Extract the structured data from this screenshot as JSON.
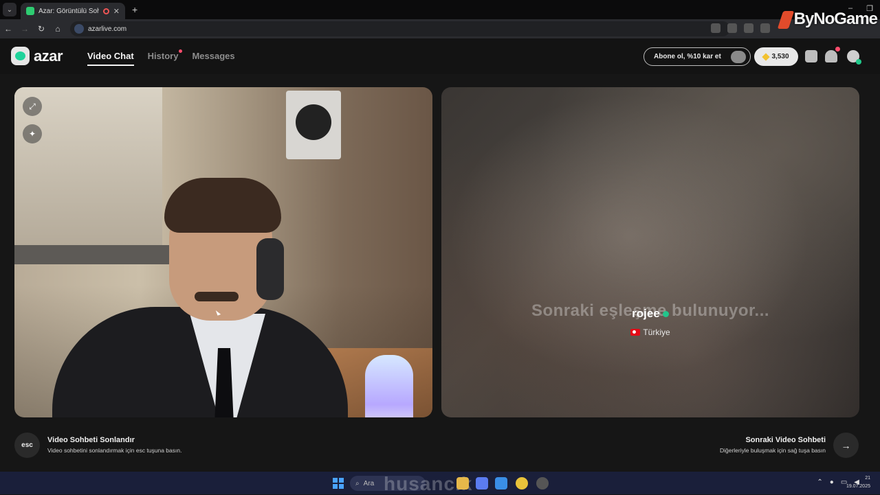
{
  "browser": {
    "tab_title": "Azar: Görüntülü Sohbet & V",
    "url": "azarlive.com"
  },
  "watermark": {
    "text": "ByNoGame"
  },
  "app": {
    "brand": "azar",
    "nav": [
      {
        "label": "Video Chat"
      },
      {
        "label": "History"
      },
      {
        "label": "Messages"
      }
    ],
    "subscribe_label": "Abone ol, %10 kar et",
    "gems": "3,530"
  },
  "remote": {
    "searching_text": "Sonraki eşleşme bulunuyor...",
    "peer_name": "rojee",
    "peer_country": "Türkiye"
  },
  "footer": {
    "esc_key": "esc",
    "end_title": "Video Sohbeti Sonlandır",
    "end_sub": "Video sohbetini sonlandırmak için esc tuşuna basın.",
    "next_title": "Sonraki Video Sohbeti",
    "next_sub": "Diğerleriyle buluşmak için sağ tuşa basın"
  },
  "taskbar": {
    "search_label": "Ara",
    "watermark": "husancık",
    "time": "21",
    "date": "19.07.2025"
  },
  "colors": {
    "accent": "#1fd39b",
    "notification": "#ff4d6d",
    "background": "#161616"
  }
}
